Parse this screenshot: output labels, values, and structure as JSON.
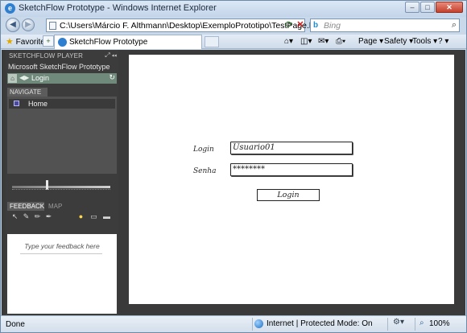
{
  "window": {
    "title": "SketchFlow Prototype - Windows Internet Explorer",
    "minimize": "–",
    "maximize": "□",
    "close": "✕"
  },
  "address": {
    "url": "C:\\Users\\Márcio F. Althmann\\Desktop\\ExemploPrototipo\\TestPage.html",
    "search_placeholder": "Bing"
  },
  "favorites_bar": {
    "favorites_label": "Favorites",
    "tab_title": "SketchFlow Prototype",
    "commands": [
      "Page ▾",
      "Safety ▾",
      "Tools ▾",
      "? ▾"
    ]
  },
  "sketchflow": {
    "header": "SKETCHFLOW PLAYER",
    "project": "Microsoft SketchFlow Prototype",
    "breadcrumb": "Login",
    "navigate_tab": "NAVIGATE",
    "nav_items": [
      "Home"
    ],
    "feedback_tab": "FEEDBACK",
    "map_tab": "MAP",
    "feedback_placeholder": "Type your feedback here"
  },
  "prototype": {
    "login_label": "Login",
    "login_value": "Usuario01",
    "password_label": "Senha",
    "password_value": "********",
    "button_label": "Login"
  },
  "status": {
    "done": "Done",
    "zone": "Internet | Protected Mode: On",
    "zoom": "100%"
  },
  "icons": [
    "ie-logo-icon",
    "back-icon",
    "forward-icon",
    "page-icon",
    "refresh-icon",
    "stop-icon",
    "bing-icon",
    "search-icon",
    "favorites-star-icon",
    "add-favorite-icon",
    "home-icon",
    "rss-icon",
    "print-icon",
    "help-icon",
    "globe-icon",
    "zoom-icon"
  ],
  "colors": {
    "ie_frame": "#c9d9ea",
    "sf_dark": "#3a3a3a",
    "sf_crumb": "#6f8a7b"
  }
}
